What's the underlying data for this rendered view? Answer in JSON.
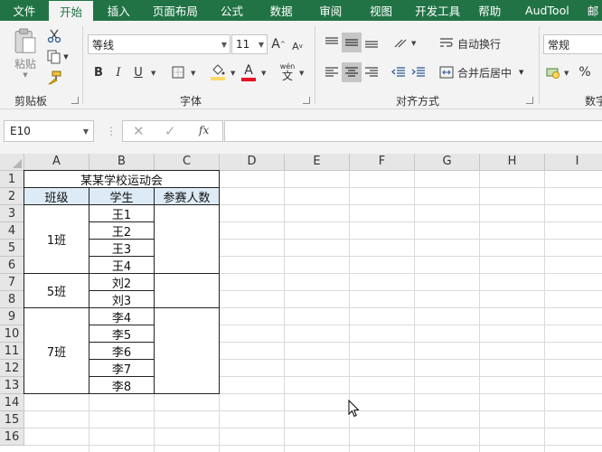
{
  "tabs": [
    "文件",
    "开始",
    "插入",
    "页面布局",
    "公式",
    "数据",
    "审阅",
    "视图",
    "开发工具",
    "帮助",
    "AudTool",
    "邮"
  ],
  "active_tab": "开始",
  "ribbon": {
    "clipboard": {
      "group_label": "剪贴板",
      "paste_label": "粘贴"
    },
    "font": {
      "group_label": "字体",
      "font_name": "等线",
      "font_size": "11",
      "bold": "B",
      "italic": "I",
      "underline": "U",
      "grow": "A",
      "shrink": "A",
      "font_color_letter": "A",
      "phonetic_top": "wén",
      "phonetic_bottom": "文"
    },
    "alignment": {
      "group_label": "对齐方式",
      "wrap_text": "自动换行",
      "merge_center": "合并后居中"
    },
    "number": {
      "group_label": "数字",
      "format": "常规",
      "percent": "%"
    },
    "colors": {
      "brand": "#217346",
      "font_color": "#e81123",
      "fill_color": "#ffd966"
    }
  },
  "formula_bar": {
    "name_box": "E10",
    "fx": "fx",
    "formula": ""
  },
  "sheet": {
    "columns": [
      "A",
      "B",
      "C",
      "D",
      "E",
      "F",
      "G",
      "H",
      "I"
    ],
    "rows": [
      "1",
      "2",
      "3",
      "4",
      "5",
      "6",
      "7",
      "8",
      "9",
      "10",
      "11",
      "12",
      "13",
      "14",
      "15",
      "16"
    ],
    "title": "某某学校运动会",
    "headers": [
      "班级",
      "学生",
      "参赛人数"
    ],
    "groups": [
      {
        "class": "1班",
        "students": [
          "王1",
          "王2",
          "王3",
          "王4"
        ]
      },
      {
        "class": "5班",
        "students": [
          "刘2",
          "刘3"
        ]
      },
      {
        "class": "7班",
        "students": [
          "李4",
          "李5",
          "李6",
          "李7",
          "李8"
        ]
      }
    ],
    "header_fill": "#ddebf7"
  }
}
